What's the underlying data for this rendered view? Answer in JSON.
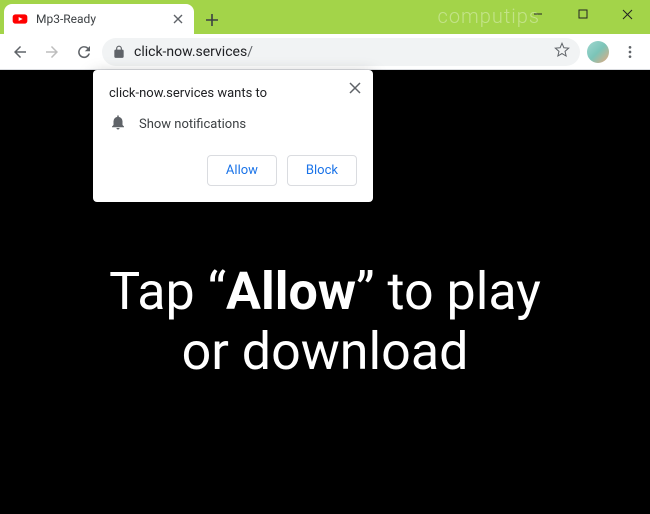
{
  "window": {
    "watermark": "computips"
  },
  "tab": {
    "title": "Mp3-Ready"
  },
  "omnibox": {
    "host": "click-now.services",
    "path": "/"
  },
  "popup": {
    "title": "click-now.services wants to",
    "permission_label": "Show notifications",
    "allow": "Allow",
    "block": "Block"
  },
  "page": {
    "line1_prefix": "Tap “",
    "line1_bold": "Allow",
    "line1_suffix": "” to play",
    "line2": "or download"
  }
}
